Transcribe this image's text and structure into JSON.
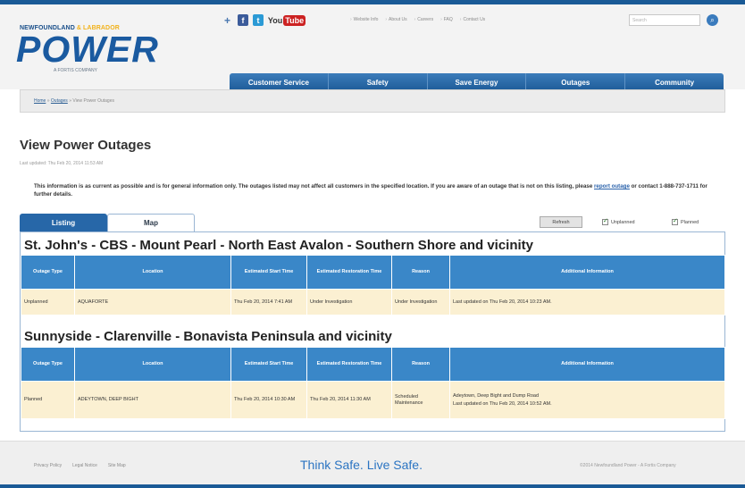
{
  "brand": {
    "logo_top": "NEWFOUNDLAND",
    "logo_top_accent": "& LABRADOR",
    "logo_main": "POWER",
    "logo_sub": "A FORTIS COMPANY",
    "primary_color": "#1a5aa0",
    "accent_color": "#f2b21b"
  },
  "social": {
    "plus_label": "+",
    "facebook_label": "f",
    "twitter_label": "t",
    "youtube_you": "You",
    "youtube_tube": "Tube"
  },
  "top_links": [
    "Website Info",
    "About Us",
    "Careers",
    "FAQ",
    "Contact Us"
  ],
  "search": {
    "placeholder": "Search",
    "button_icon": "⌕"
  },
  "nav": [
    "Customer Service",
    "Safety",
    "Save Energy",
    "Outages",
    "Community"
  ],
  "breadcrumb": {
    "home": "Home",
    "sep1": " » ",
    "outages": "Outages",
    "sep2": " » ",
    "current": "View Power Outages"
  },
  "page": {
    "title": "View Power Outages",
    "updated": "Last updated: Thu Feb 20, 2014 11:53 AM",
    "notice_a": "This information is as current as possible and is for general information only. The outages listed may not affect all customers in the specified location. If you are aware of an outage that is not on this listing, please ",
    "notice_link": "report outage",
    "notice_b": " or contact 1-888-737-1711 for further details."
  },
  "tabs": {
    "listing": "Listing",
    "map": "Map"
  },
  "controls": {
    "refresh": "Refresh",
    "unplanned": "Unplanned",
    "planned": "Planned"
  },
  "columns": {
    "type": "Outage Type",
    "location": "Location",
    "start": "Estimated Start Time",
    "restoration": "Estimated Restoration Time",
    "reason": "Reason",
    "info": "Additional Information"
  },
  "regions": [
    {
      "name": "St. John's - CBS - Mount Pearl - North East Avalon - Southern Shore and vicinity",
      "rows": [
        {
          "type": "Unplanned",
          "location": "AQUAFORTE",
          "start": "Thu Feb 20, 2014 7:41 AM",
          "restoration": "Under Investigation",
          "reason": "Under Investigation",
          "info_line1": "Last updated on Thu Feb 20, 2014 10:23 AM.",
          "info_line2": ""
        }
      ]
    },
    {
      "name": "Sunnyside - Clarenville - Bonavista Peninsula and vicinity",
      "rows": [
        {
          "type": "Planned",
          "location": "ADEYTOWN, DEEP BIGHT",
          "start": "Thu Feb 20, 2014 10:30 AM",
          "restoration": "Thu Feb 20, 2014 11:30 AM",
          "reason": "Scheduled Maintenance",
          "info_line1": "Adeytown, Deep Bight and Dump Road",
          "info_line2": "Last updated on Thu Feb 20, 2014 10:52 AM."
        }
      ]
    }
  ],
  "footer": {
    "links": [
      "Privacy Policy",
      "Legal Notice",
      "Site Map"
    ],
    "slogan": "Think Safe. Live Safe.",
    "copyright": "©2014 Newfoundland Power - A Fortis Company"
  }
}
